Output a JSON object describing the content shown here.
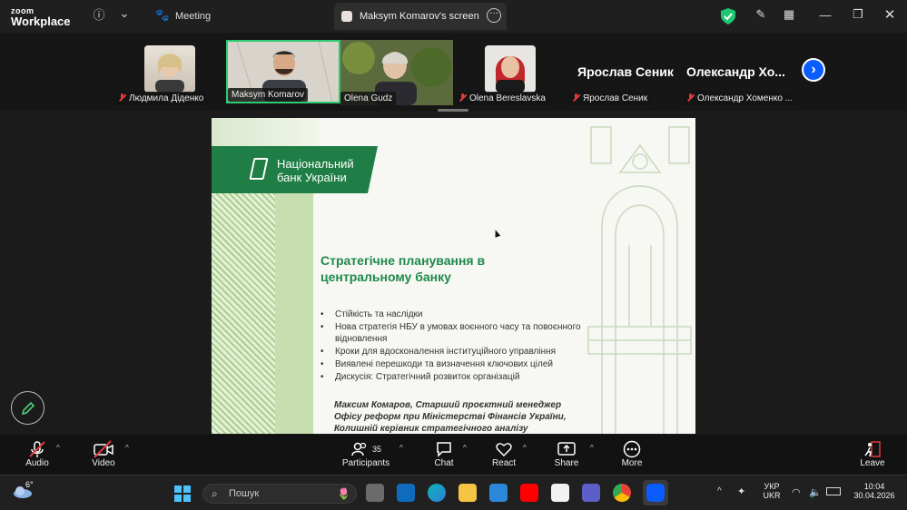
{
  "app": {
    "logo_top": "zoom",
    "logo_bottom": "Workplace",
    "meeting_label": "Meeting"
  },
  "screen_tab": {
    "title": "Maksym Komarov's screen"
  },
  "participants": [
    {
      "name": "Людмила Діденко",
      "muted": true
    },
    {
      "name": "Maksym Komarov",
      "muted": false,
      "active": true
    },
    {
      "name": "Olena Gudz",
      "muted": false
    },
    {
      "name": "Olena Bereslavska",
      "muted": true
    },
    {
      "name": "Ярослав Сеник",
      "display": "Ярослав Сеник",
      "muted": true
    },
    {
      "name": "Олександр Хоменко ...",
      "display": "Олександр  Хо...",
      "muted": true
    }
  ],
  "slide": {
    "bank_line1": "Національний",
    "bank_line2": "банк України",
    "title_line1": "Стратегічне планування в",
    "title_line2": "центральному банку",
    "bullets": [
      "Стійкість та наслідки",
      "Нова стратегія НБУ в умовах воєнного часу та повоєнного відновлення",
      "Кроки для вдосконалення інституційного управління",
      "Виявлені перешкоди та визначення ключових цілей",
      "Дискусія: Стратегічний розвиток організацій"
    ],
    "author_line1": "Максим Комаров, Старший проєктний менеджер",
    "author_line2": "Офісу реформ при Міністерстві Фінансів України,",
    "author_line3": "Колишній керівник стратегічного аналізу"
  },
  "toolbar": {
    "audio": "Audio",
    "video": "Video",
    "participants": "Participants",
    "participants_count": "35",
    "chat": "Chat",
    "react": "React",
    "share": "Share",
    "more": "More",
    "leave": "Leave"
  },
  "taskbar": {
    "weather": "6°",
    "search_placeholder": "Пошук",
    "lang_top": "УКР",
    "lang_bottom": "UKR",
    "time": "10:04",
    "date": "30.04.2026"
  },
  "colors": {
    "accent": "#0b5cff",
    "bank_green": "#1e7e45",
    "active_border": "#2ecc71",
    "shield": "#1ec773"
  }
}
